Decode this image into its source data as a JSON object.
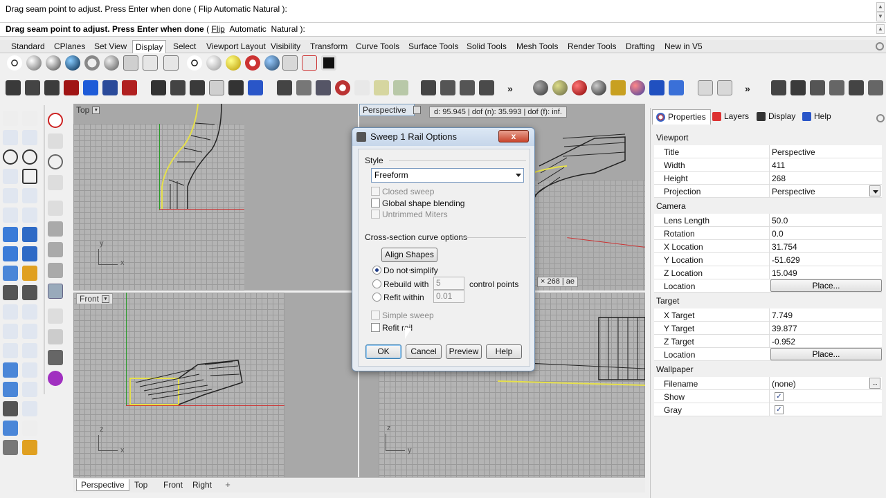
{
  "command": {
    "history_line": "Drag seam point to adjust. Press Enter when done ( Flip  Automatic  Natural ):",
    "prompt_bold": "Drag seam point to adjust. Press Enter when done",
    "prompt_open": " ( ",
    "prompt_opt1": "Flip",
    "prompt_opt2": "Automatic",
    "prompt_opt3": "Natural",
    "prompt_close": " ):"
  },
  "tabs": [
    "Standard",
    "CPlanes",
    "Set View",
    "Display",
    "Select",
    "Viewport Layout",
    "Visibility",
    "Transform",
    "Curve Tools",
    "Surface Tools",
    "Solid Tools",
    "Mesh Tools",
    "Render Tools",
    "Drafting",
    "New in V5"
  ],
  "active_tab": "Display",
  "viewports": {
    "top": "Top",
    "front": "Front",
    "perspective": "Perspective",
    "persp_info": "d: 95.945  |  dof (n): 35.993  |  dof (f): inf.",
    "persp_size": "× 268  |  ae",
    "tabs": [
      "Perspective",
      "Top",
      "Front",
      "Right"
    ],
    "add_tab": "+",
    "axis_y": "y",
    "axis_x": "x",
    "axis_z": "z"
  },
  "dialog": {
    "title": "Sweep 1 Rail Options",
    "close": "x",
    "style_label": "Style",
    "style_value": "Freeform",
    "closed_sweep": "Closed sweep",
    "global_blending": "Global shape blending",
    "untrimmed_miters": "Untrimmed Miters",
    "cross_section": "Cross-section curve options",
    "align_shapes": "Align Shapes ...",
    "do_not_simplify": "Do not simplify",
    "rebuild_with": "Rebuild with",
    "rebuild_value": "5",
    "control_points": "control points",
    "refit_within": "Refit within",
    "refit_value": "0.01",
    "simple_sweep": "Simple sweep",
    "refit_rail": "Refit rail",
    "ok": "OK",
    "cancel": "Cancel",
    "preview": "Preview",
    "help": "Help"
  },
  "panel": {
    "tabs": [
      "Properties",
      "Layers",
      "Display",
      "Help"
    ],
    "viewport_section": "Viewport",
    "title_k": "Title",
    "title_v": "Perspective",
    "width_k": "Width",
    "width_v": "411",
    "height_k": "Height",
    "height_v": "268",
    "projection_k": "Projection",
    "projection_v": "Perspective",
    "camera_section": "Camera",
    "lens_k": "Lens Length",
    "lens_v": "50.0",
    "rotation_k": "Rotation",
    "rotation_v": "0.0",
    "xloc_k": "X Location",
    "xloc_v": "31.754",
    "yloc_k": "Y Location",
    "yloc_v": "-51.629",
    "zloc_k": "Z Location",
    "zloc_v": "15.049",
    "cam_location_k": "Location",
    "place": "Place...",
    "target_section": "Target",
    "xt_k": "X Target",
    "xt_v": "7.749",
    "yt_k": "Y Target",
    "yt_v": "39.877",
    "zt_k": "Z Target",
    "zt_v": "-0.952",
    "tgt_location_k": "Location",
    "wallpaper_section": "Wallpaper",
    "filename_k": "Filename",
    "filename_v": "(none)",
    "show_k": "Show",
    "gray_k": "Gray",
    "dots": "...",
    "check": "✓"
  }
}
